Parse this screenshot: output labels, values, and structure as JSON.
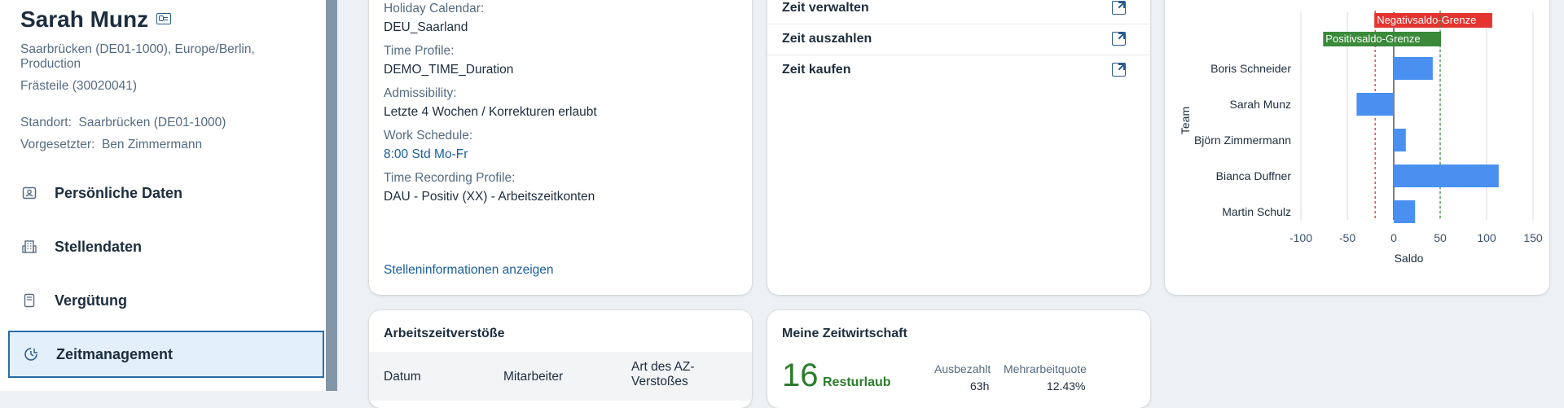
{
  "profile": {
    "name": "Sarah Munz",
    "location": "Saarbrücken (DE01-1000), Europe/Berlin,",
    "division": "Production",
    "department": "Frästeile (30020041)",
    "standort_label": "Standort:",
    "standort_value": "Saarbrücken (DE01-1000)",
    "vorgesetzter_label": "Vorgesetzter:",
    "vorgesetzter_value": "Ben Zimmermann"
  },
  "nav": {
    "items": [
      {
        "label": "Persönliche Daten",
        "icon": "person-card-icon"
      },
      {
        "label": "Stellendaten",
        "icon": "building-icon"
      },
      {
        "label": "Vergütung",
        "icon": "payment-icon"
      },
      {
        "label": "Zeitmanagement",
        "icon": "time-account-icon",
        "active": true
      }
    ]
  },
  "job_card": {
    "fields": [
      {
        "label": "Holiday Calendar:",
        "value": "DEU_Saarland"
      },
      {
        "label": "Time Profile:",
        "value": "DEMO_TIME_Duration"
      },
      {
        "label": "Admissibility:",
        "value": "Letzte 4 Wochen / Korrekturen erlaubt"
      },
      {
        "label": "Work Schedule:",
        "value": "8:00 Std Mo-Fr"
      },
      {
        "label": "Time Recording Profile:",
        "value": "DAU - Positiv (XX) - Arbeitszeitkonten"
      }
    ],
    "link": "Stelleninformationen anzeigen"
  },
  "actions_card": {
    "items": [
      "Zeit verwalten",
      "Zeit auszahlen",
      "Zeit kaufen"
    ]
  },
  "violations_card": {
    "title": "Arbeitszeitverstöße",
    "columns": [
      "Datum",
      "Mitarbeiter",
      "Art des AZ-",
      "Verstoßes"
    ]
  },
  "zeitwirtschaft_card": {
    "title": "Meine Zeitwirtschaft",
    "number": "16",
    "number_label": "Resturlaub",
    "col1_label": "Ausbezahlt",
    "col1_value": "63h",
    "col2_label": "Mehrarbeitquote",
    "col2_value": "12.43%"
  },
  "colors": {
    "accent": "#1a5f9e",
    "bar": "#4a90f0",
    "negative_limit": "#e3342f",
    "positive_limit": "#3a8a3a",
    "active_nav_bg": "#e3f0fb"
  },
  "chart_data": {
    "type": "bar",
    "orientation": "horizontal",
    "categories": [
      "Boris Schneider",
      "Sarah Munz",
      "Björn Zimmermann",
      "Bianca Duffner",
      "Martin Schulz"
    ],
    "values": [
      42,
      -40,
      13,
      113,
      23
    ],
    "xlabel": "Saldo",
    "ylabel": "Team",
    "xlim": [
      -100,
      150
    ],
    "xticks": [
      -100,
      -50,
      0,
      50,
      100,
      150
    ],
    "grid": true,
    "annotations": [
      {
        "label": "Negativsaldo-Grenze",
        "x": -20,
        "color": "#e3342f"
      },
      {
        "label": "Positivsaldo-Grenze",
        "x": 50,
        "color": "#3a8a3a"
      }
    ]
  }
}
